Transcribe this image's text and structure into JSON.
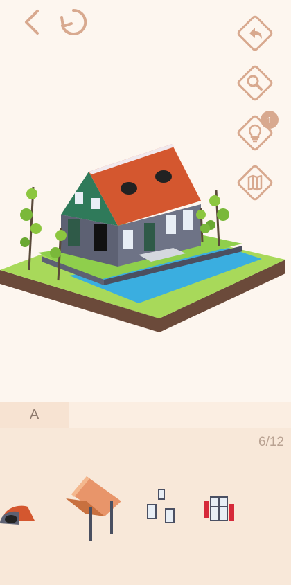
{
  "toolbar": {
    "back_icon": "chevron-left-icon",
    "restart_icon": "restart-icon"
  },
  "side_buttons": [
    {
      "icon": "undo-icon"
    },
    {
      "icon": "magnifier-icon"
    },
    {
      "icon": "lightbulb-icon",
      "badge": "1"
    },
    {
      "icon": "map-icon"
    }
  ],
  "scene": {
    "description_icon": "isometric-house-island"
  },
  "tray": {
    "tab_label": "A",
    "progress": "6/12",
    "pieces": [
      {
        "icon": "roof-dormer-piece"
      },
      {
        "icon": "porch-canopy-piece"
      },
      {
        "icon": "windows-piece"
      },
      {
        "icon": "red-shutter-window-piece"
      }
    ]
  },
  "colors": {
    "background": "#fdf6ef",
    "accent": "#d8a98f",
    "roof": "#d4572f",
    "house_green": "#2f7a5a",
    "house_grey": "#5d6173",
    "grass": "#9fd14a",
    "water": "#3aaee0"
  }
}
